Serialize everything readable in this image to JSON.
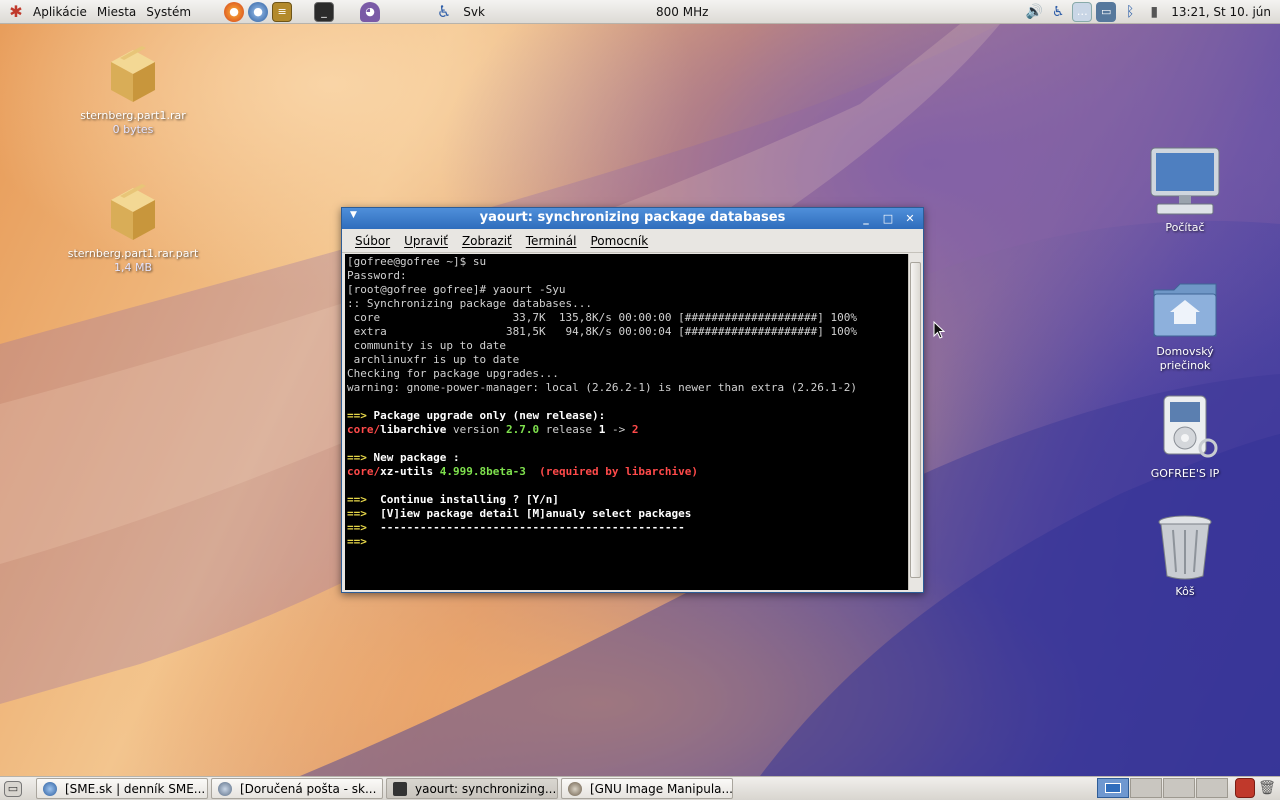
{
  "top_panel": {
    "menus": [
      "Aplikácie",
      "Miesta",
      "Systém"
    ],
    "keyboard": "Svk",
    "cpu": "800 MHz",
    "clock": "13:21, St 10. jún"
  },
  "desktop_icons": [
    {
      "label": "sternberg.part1.rar",
      "sub": "0 bytes",
      "icon": "archive-icon"
    },
    {
      "label": "sternberg.part1.rar.part",
      "sub": "1,4 MB",
      "icon": "archive-icon"
    },
    {
      "label": "Počítač",
      "sub": "",
      "icon": "computer-icon"
    },
    {
      "label": "Domovský priečinok",
      "sub": "",
      "icon": "home-folder-icon"
    },
    {
      "label": "GOFREE'S IP",
      "sub": "",
      "icon": "ipod-icon"
    },
    {
      "label": "Kôš",
      "sub": "",
      "icon": "trash-icon"
    }
  ],
  "window": {
    "title": "yaourt: synchronizing package databases",
    "menu": [
      "Súbor",
      "Upraviť",
      "Zobraziť",
      "Terminál",
      "Pomocník"
    ]
  },
  "terminal": {
    "l1": "[gofree@gofree ~]$ su",
    "l2": "Password:",
    "l3": "[root@gofree gofree]# yaourt -Syu",
    "l4": ":: Synchronizing package databases...",
    "l5": " core                    33,7K  135,8K/s 00:00:00 [####################] 100%",
    "l6": " extra                  381,5K   94,8K/s 00:00:04 [####################] 100%",
    "l7": " community is up to date",
    "l8": " archlinuxfr is up to date",
    "l9": "Checking for package upgrades...",
    "l10": "warning: gnome-power-manager: local (2.26.2-1) is newer than extra (2.26.1-2)",
    "arrow": "==>",
    "l12": "Package upgrade only (new release):",
    "l13a": "core/",
    "l13b": "libarchive",
    "l13c": " version ",
    "l13d": "2.7.0",
    "l13e": " release ",
    "l13f": "1",
    "l13g": " -> ",
    "l13h": "2",
    "l15": "New package :",
    "l16a": "core/",
    "l16b": "xz-utils",
    "l16c": "4.999.8beta-3",
    "l16d": "(required by libarchive)",
    "l18": "Continue installing ? [Y/n]",
    "l19": "[V]iew package detail [M]anualy select packages",
    "l20": "----------------------------------------------"
  },
  "taskbar": [
    {
      "label": "[SME.sk | denník SME...",
      "icon": "firefox-icon"
    },
    {
      "label": "[Doručená pošta - sk...",
      "icon": "thunderbird-icon"
    },
    {
      "label": "yaourt: synchronizing...",
      "icon": "terminal-icon"
    },
    {
      "label": "[GNU Image Manipula...",
      "icon": "gimp-icon"
    }
  ]
}
